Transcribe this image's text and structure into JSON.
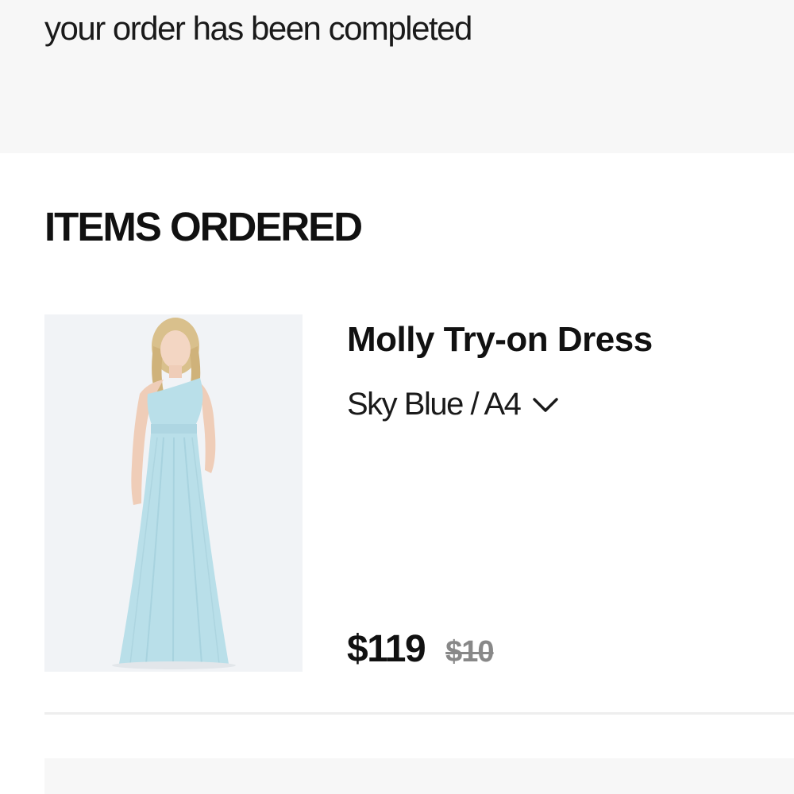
{
  "banner": {
    "message": "your order has been completed"
  },
  "items_section": {
    "title": "ITEMS ORDERED",
    "items": [
      {
        "name": "Molly Try-on Dress",
        "variant": "Sky Blue / A4",
        "price": "$119",
        "original_price": "$10",
        "image_icon": "dress-photo",
        "dress_color": "#b9dfe9"
      }
    ]
  },
  "icons": {
    "variant_dropdown": "chevron-down-icon"
  },
  "colors": {
    "banner_background": "#f7f7f7",
    "text_primary": "#111111",
    "strikethrough_price": "#888888"
  }
}
